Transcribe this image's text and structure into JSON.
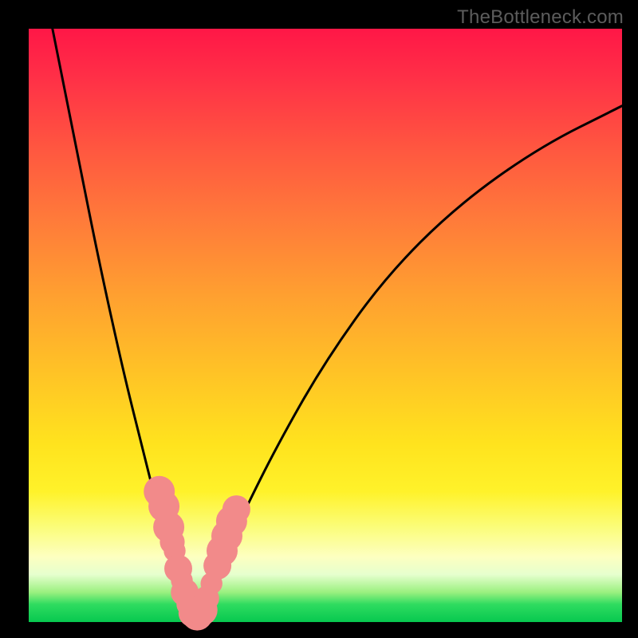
{
  "watermark": "TheBottleneck.com",
  "chart_data": {
    "type": "line",
    "title": "",
    "xlabel": "",
    "ylabel": "",
    "xlim": [
      0,
      100
    ],
    "ylim": [
      0,
      100
    ],
    "grid": false,
    "legend": false,
    "series": [
      {
        "name": "bottleneck-curve",
        "x": [
          4,
          8,
          12,
          16,
          19,
          22,
          24,
          26,
          27.5,
          29,
          32,
          36,
          42,
          50,
          60,
          72,
          86,
          100
        ],
        "y": [
          100,
          80,
          60,
          42,
          30,
          18,
          10,
          4,
          1,
          3,
          9,
          18,
          30,
          44,
          58,
          70,
          80,
          87
        ]
      }
    ],
    "markers": [
      {
        "name": "highlight-dots",
        "color": "#f28a8a",
        "points": [
          {
            "x": 22.0,
            "y": 22.0,
            "r": 1.6
          },
          {
            "x": 22.8,
            "y": 19.5,
            "r": 1.6
          },
          {
            "x": 23.6,
            "y": 16.0,
            "r": 1.6
          },
          {
            "x": 24.2,
            "y": 13.5,
            "r": 1.2
          },
          {
            "x": 24.6,
            "y": 12.0,
            "r": 1.0
          },
          {
            "x": 25.2,
            "y": 9.0,
            "r": 1.4
          },
          {
            "x": 25.8,
            "y": 7.0,
            "r": 1.0
          },
          {
            "x": 26.3,
            "y": 5.0,
            "r": 1.4
          },
          {
            "x": 27.0,
            "y": 3.0,
            "r": 1.2
          },
          {
            "x": 27.6,
            "y": 1.5,
            "r": 1.4
          },
          {
            "x": 28.4,
            "y": 1.2,
            "r": 1.6
          },
          {
            "x": 29.2,
            "y": 2.0,
            "r": 1.6
          },
          {
            "x": 30.0,
            "y": 4.0,
            "r": 1.2
          },
          {
            "x": 30.8,
            "y": 6.5,
            "r": 1.0
          },
          {
            "x": 31.8,
            "y": 9.5,
            "r": 1.4
          },
          {
            "x": 32.6,
            "y": 12.0,
            "r": 1.6
          },
          {
            "x": 33.4,
            "y": 14.5,
            "r": 1.6
          },
          {
            "x": 34.2,
            "y": 17.0,
            "r": 1.6
          },
          {
            "x": 35.0,
            "y": 19.0,
            "r": 1.4
          }
        ]
      }
    ]
  },
  "colors": {
    "curve": "#000000",
    "marker": "#f28a8a",
    "background_black": "#000000"
  }
}
